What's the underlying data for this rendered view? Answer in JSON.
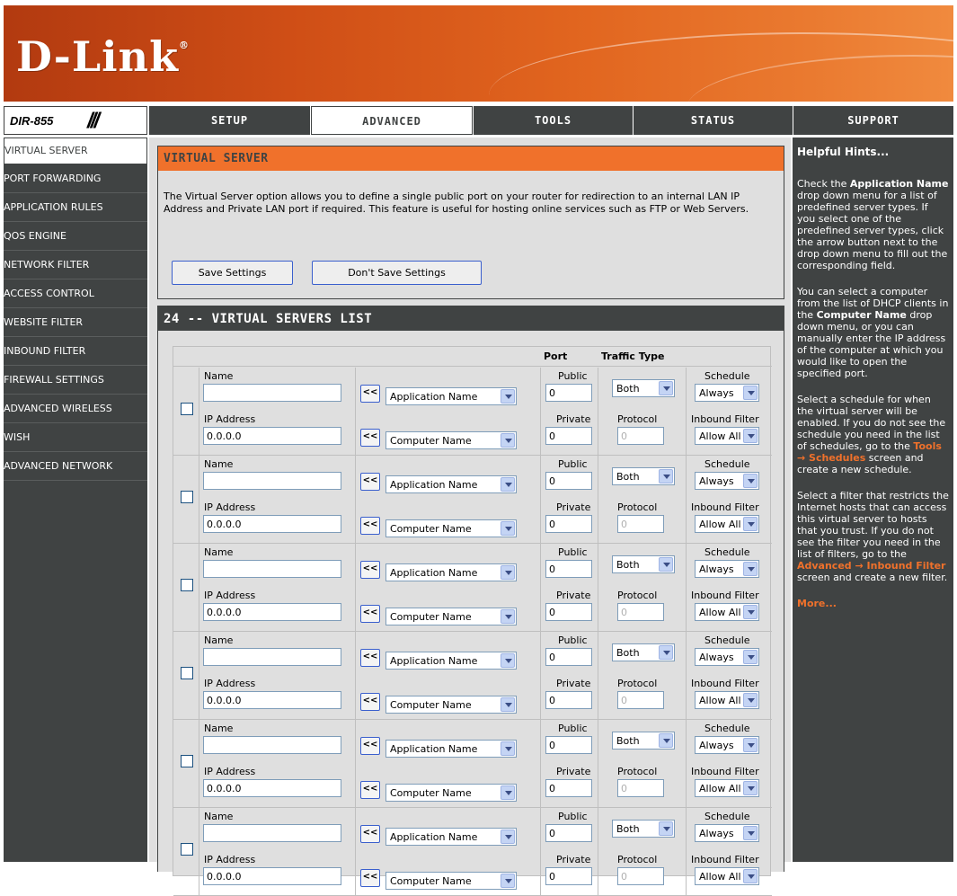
{
  "brand": {
    "logo": "D-Link",
    "reg": "®",
    "model": "DIR-855",
    "slashes": "///"
  },
  "nav": {
    "tabs": [
      "SETUP",
      "ADVANCED",
      "TOOLS",
      "STATUS",
      "SUPPORT"
    ],
    "active": "ADVANCED"
  },
  "sidebar": {
    "items": [
      "VIRTUAL SERVER",
      "PORT FORWARDING",
      "APPLICATION RULES",
      "QOS ENGINE",
      "NETWORK FILTER",
      "ACCESS CONTROL",
      "WEBSITE FILTER",
      "INBOUND FILTER",
      "FIREWALL SETTINGS",
      "ADVANCED WIRELESS",
      "WISH",
      "ADVANCED NETWORK"
    ],
    "active": "VIRTUAL SERVER"
  },
  "intro": {
    "title": "VIRTUAL SERVER",
    "text": "The Virtual Server option allows you to define a single public port on your router for redirection to an internal LAN IP Address and Private LAN port if required. This feature is useful for hosting online services such as FTP or Web Servers.",
    "save_label": "Save Settings",
    "dont_save_label": "Don't Save Settings"
  },
  "list": {
    "title": "24 -- VIRTUAL SERVERS LIST",
    "header_port": "Port",
    "header_traffic": "Traffic Type",
    "labels": {
      "name": "Name",
      "ip": "IP Address",
      "public": "Public",
      "private": "Private",
      "protocol": "Protocol",
      "schedule": "Schedule",
      "inbound": "Inbound Filter",
      "arrow": "<<"
    },
    "defaults": {
      "name_value": "",
      "ip_value": "0.0.0.0",
      "app_select": "Application Name",
      "computer_select": "Computer Name",
      "public_value": "0",
      "private_value": "0",
      "protocol_value": "0",
      "traffic_value": "Both",
      "schedule_value": "Always",
      "inbound_value": "Allow All"
    }
  },
  "support": {
    "title": "Helpful Hints...",
    "hint1_pre": "Check the ",
    "hint1_b": "Application Name",
    "hint1_post": " drop down menu for a list of predefined server types. If you select one of the predefined server types, click the arrow button next to the drop down menu to fill out the corresponding field.",
    "hint2_pre": "You can select a computer from the list of DHCP clients in the ",
    "hint2_b": "Computer Name",
    "hint2_post": " drop down menu, or you can manually enter the IP address of the computer at which you would like to open the specified port.",
    "hint3_pre": "Select a schedule for when the virtual server will be enabled. If you do not see the schedule you need in the list of schedules, go to the ",
    "hint3_b": "Tools → Schedules",
    "hint3_post": " screen and create a new schedule.",
    "hint4_pre": "Select a filter that restricts the Internet hosts that can access this virtual server to hosts that you trust. If you do not see the filter you need in the list of filters, go to the ",
    "hint4_b": "Advanced → Inbound Filter",
    "hint4_post": " screen and create a new filter.",
    "more": "More..."
  }
}
